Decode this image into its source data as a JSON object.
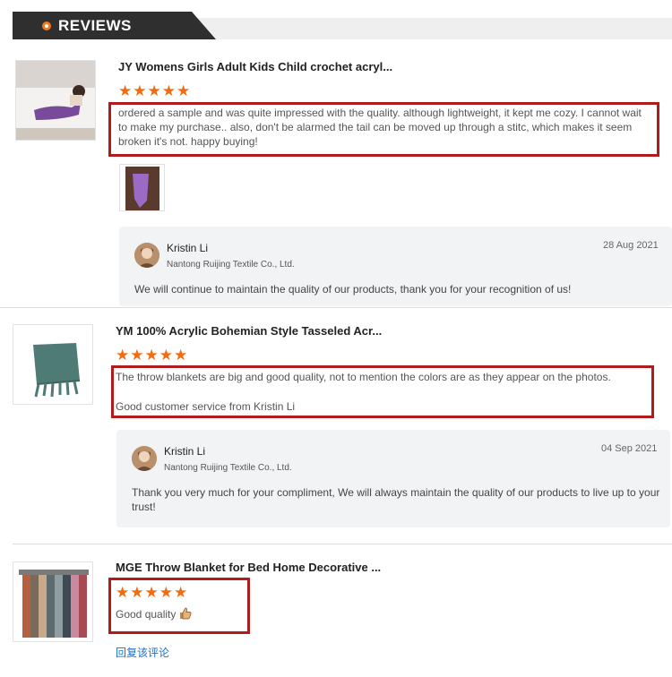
{
  "header": {
    "title": "REVIEWS",
    "accent": "#f07a1c"
  },
  "reviews": [
    {
      "product_title": "JY Womens Girls Adult Kids Child crochet acryl...",
      "rating": 5,
      "text": "ordered a sample and was quite impressed with the quality. although lightweight, it kept me cozy. I cannot wait to make my purchase.. also, don't be alarmed the tail can be moved up through a stitc, which makes it seem broken it's not. happy buying!",
      "has_photo": true,
      "reply": {
        "name": "Kristin Li",
        "company": "Nantong Ruijing Textile Co., Ltd.",
        "date": "28 Aug 2021",
        "text": "We will continue to maintain the quality of our products, thank you for your recognition of us!"
      }
    },
    {
      "product_title": "YM 100% Acrylic Bohemian Style Tasseled Acr...",
      "rating": 5,
      "text_line1": "The throw blankets are big and good quality, not to mention the colors are as they appear on the photos.",
      "text_line2": "Good customer service from Kristin Li",
      "reply": {
        "name": "Kristin Li",
        "company": "Nantong Ruijing Textile Co., Ltd.",
        "date": "04 Sep 2021",
        "text": "Thank you very much for your compliment, We will always maintain the quality of our products to live up to your trust!"
      }
    },
    {
      "product_title": "MGE Throw Blanket for Bed Home Decorative ...",
      "rating": 5,
      "text": "Good quality",
      "emoji": "thumbs-up-icon",
      "reply_link": "回复该评论"
    }
  ],
  "stars": "★★★★★",
  "colors": {
    "star": "#f26b0f",
    "highlight_box": "#b01c1c",
    "link": "#1a6fc6"
  }
}
